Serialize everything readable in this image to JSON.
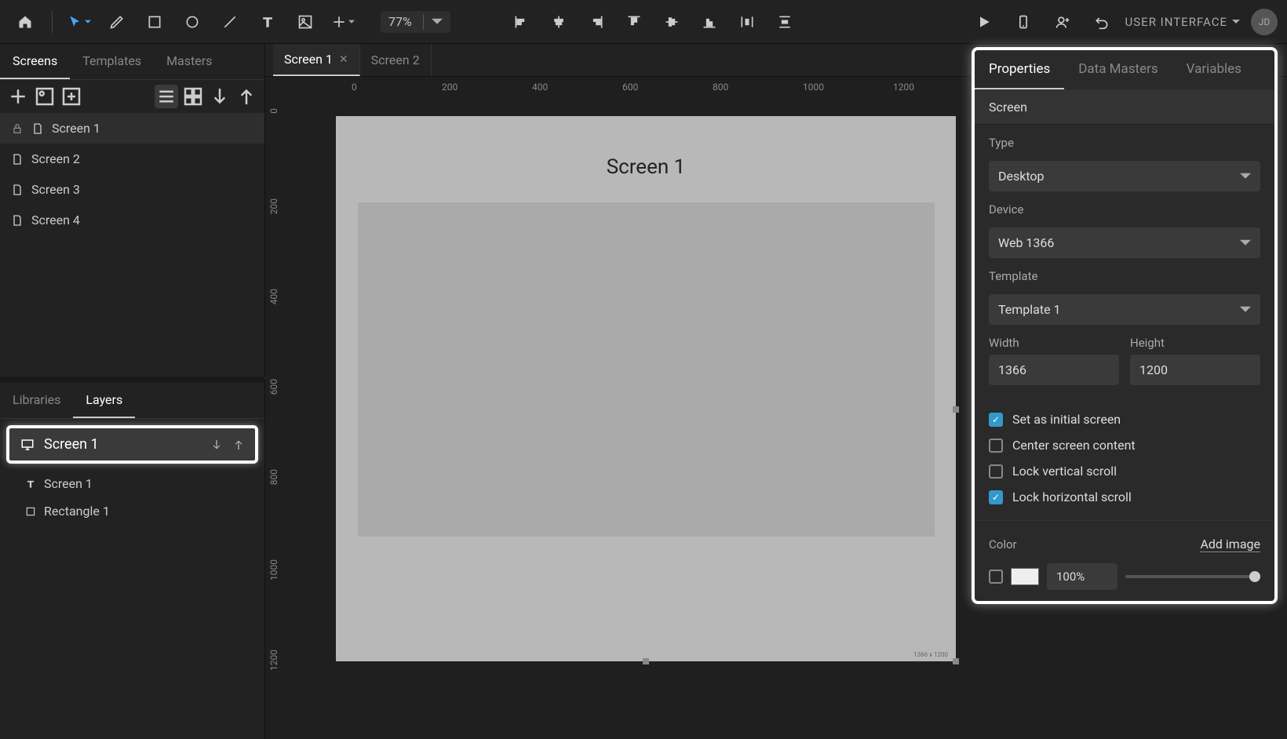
{
  "topbar": {
    "zoom": "77%",
    "user_label": "USER INTERFACE",
    "avatar": "JD"
  },
  "left_panel": {
    "tabs": [
      "Screens",
      "Templates",
      "Masters"
    ],
    "active_tab": 0,
    "screens": [
      "Screen 1",
      "Screen 2",
      "Screen 3",
      "Screen 4"
    ],
    "active_screen": 0,
    "lower_tabs": [
      "Libraries",
      "Layers"
    ],
    "lower_active": 1,
    "layer_header": "Screen 1",
    "layers": [
      {
        "icon": "text",
        "label": "Screen 1"
      },
      {
        "icon": "rect",
        "label": "Rectangle 1"
      }
    ]
  },
  "canvas": {
    "tabs": [
      "Screen 1",
      "Screen 2"
    ],
    "active_tab": 0,
    "ruler_h": [
      "0",
      "200",
      "400",
      "600",
      "800",
      "1000",
      "1200"
    ],
    "ruler_v": [
      "0",
      "200",
      "400",
      "600",
      "800",
      "1000",
      "1200"
    ],
    "artboard_title": "Screen 1",
    "dim_label": "1366 x 1200"
  },
  "right_panel": {
    "tabs": [
      "Properties",
      "Data Masters",
      "Variables"
    ],
    "active_tab": 0,
    "section_title": "Screen",
    "type_label": "Type",
    "type_value": "Desktop",
    "device_label": "Device",
    "device_value": "Web 1366",
    "template_label": "Template",
    "template_value": "Template 1",
    "width_label": "Width",
    "width_value": "1366",
    "height_label": "Height",
    "height_value": "1200",
    "checks": [
      {
        "label": "Set as initial screen",
        "checked": true
      },
      {
        "label": "Center screen content",
        "checked": false
      },
      {
        "label": "Lock vertical scroll",
        "checked": false
      },
      {
        "label": "Lock horizontal scroll",
        "checked": true
      }
    ],
    "color_label": "Color",
    "add_image": "Add image",
    "opacity": "100%"
  }
}
